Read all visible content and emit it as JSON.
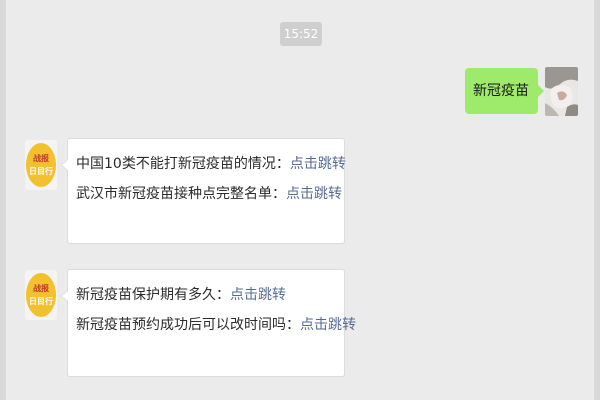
{
  "timestamp": "15:52",
  "outgoing": {
    "text": "新冠疫苗"
  },
  "bot_avatar": {
    "line1": "战报",
    "line2": "日目行",
    "bg": "#f3c12d"
  },
  "messages": [
    {
      "items": [
        {
          "text": "中国10类不能打新冠疫苗的情况：",
          "link": "点击跳转"
        },
        {
          "text": "武汉市新冠疫苗接种点完整名单：",
          "link": "点击跳转"
        }
      ]
    },
    {
      "items": [
        {
          "text": "新冠疫苗保护期有多久：",
          "link": "点击跳转"
        },
        {
          "text": "新冠疫苗预约成功后可以改时间吗：",
          "link": "点击跳转"
        }
      ]
    }
  ],
  "colors": {
    "link": "#576b95",
    "outgoing_bubble": "#9eea6a",
    "chat_bg": "#ebebeb"
  }
}
